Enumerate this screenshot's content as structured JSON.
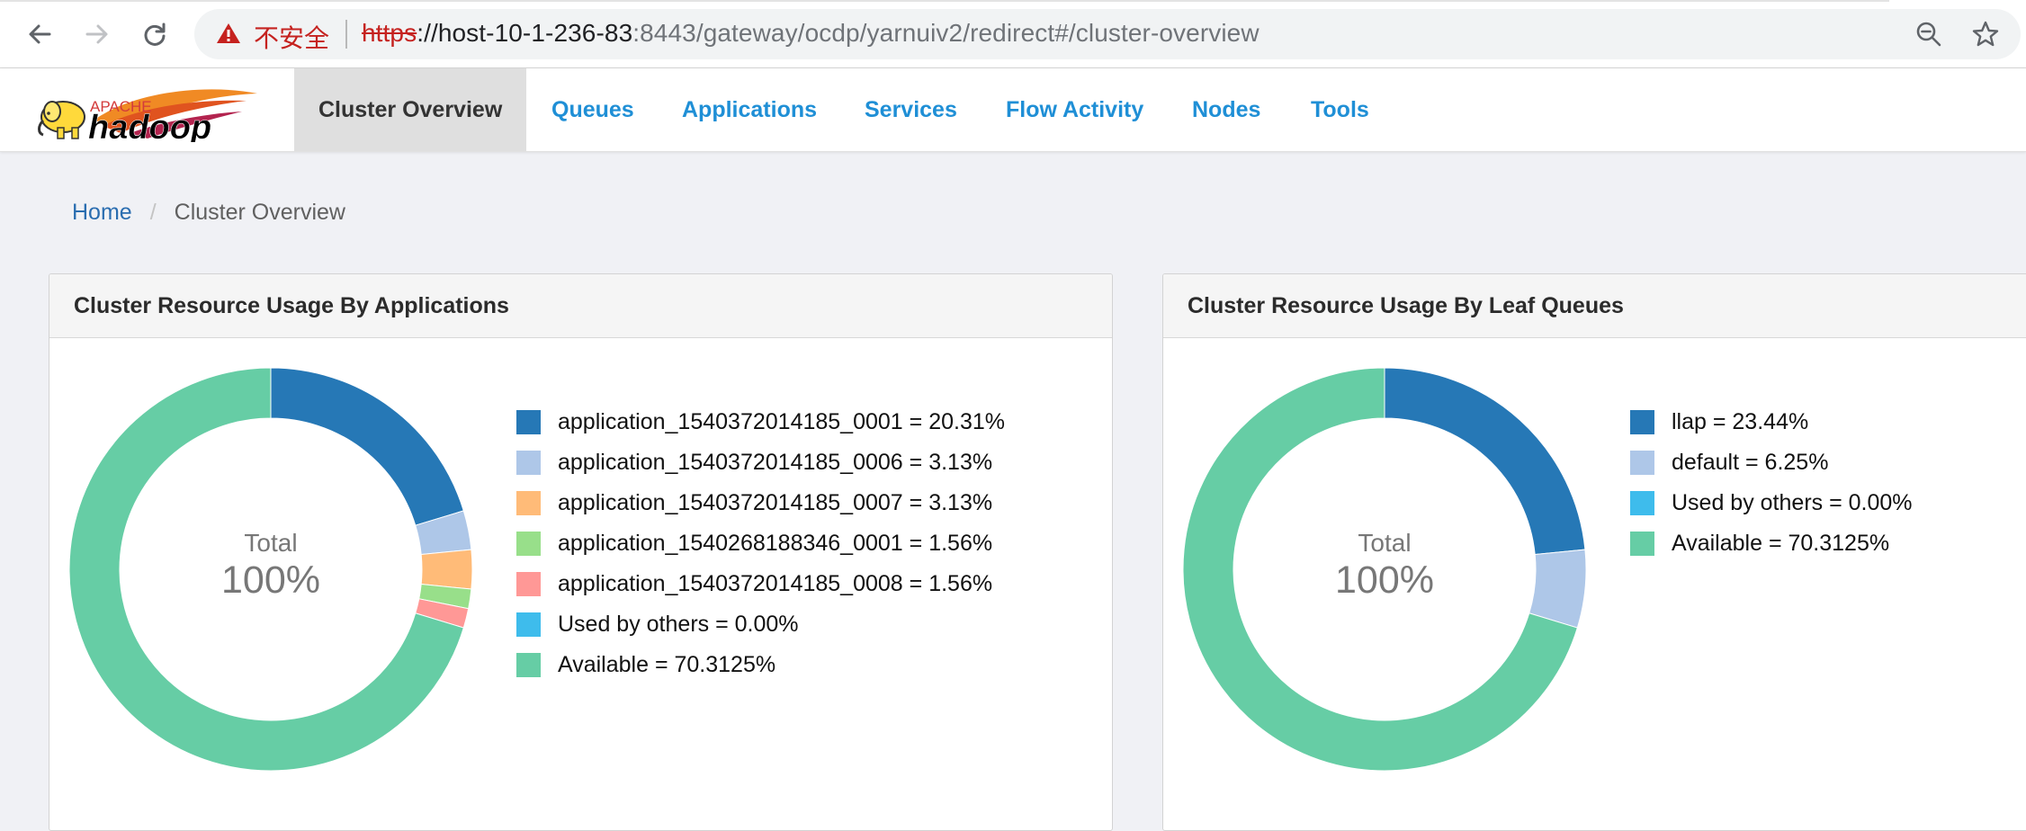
{
  "browser": {
    "security_label": "不安全",
    "url_scheme": "https",
    "url_host": "://host-10-1-236-83",
    "url_path": ":8443/gateway/ocdp/yarnuiv2/redirect#/cluster-overview"
  },
  "logo": {
    "apache": "APACHE",
    "hadoop": "hadoop"
  },
  "nav": {
    "active": "Cluster Overview",
    "items": [
      "Queues",
      "Applications",
      "Services",
      "Flow Activity",
      "Nodes",
      "Tools"
    ]
  },
  "breadcrumb": {
    "home": "Home",
    "separator": "/",
    "current": "Cluster Overview"
  },
  "chart_data": [
    {
      "type": "pie",
      "variant": "donut",
      "title": "Cluster Resource Usage By Applications",
      "center_label": "Total",
      "center_value": "100%",
      "slices": [
        {
          "label": "application_1540372014185_0001 = 20.31%",
          "value": 20.31,
          "color": "#2678b6"
        },
        {
          "label": "application_1540372014185_0006 = 3.13%",
          "value": 3.13,
          "color": "#aec7e8"
        },
        {
          "label": "application_1540372014185_0007 = 3.13%",
          "value": 3.13,
          "color": "#ffbb78"
        },
        {
          "label": "application_1540268188346_0001 = 1.56%",
          "value": 1.56,
          "color": "#98df8a"
        },
        {
          "label": "application_1540372014185_0008 = 1.56%",
          "value": 1.56,
          "color": "#ff9896"
        },
        {
          "label": "Used by others = 0.00%",
          "value": 0,
          "color": "#3ebcec"
        },
        {
          "label": "Available = 70.3125%",
          "value": 70.3125,
          "color": "#66cda5"
        }
      ]
    },
    {
      "type": "pie",
      "variant": "donut",
      "title": "Cluster Resource Usage By Leaf Queues",
      "center_label": "Total",
      "center_value": "100%",
      "slices": [
        {
          "label": "llap = 23.44%",
          "value": 23.44,
          "color": "#2678b6"
        },
        {
          "label": "default = 6.25%",
          "value": 6.25,
          "color": "#aec7e8"
        },
        {
          "label": "Used by others = 0.00%",
          "value": 0,
          "color": "#3ebcec"
        },
        {
          "label": "Available = 70.3125%",
          "value": 70.3125,
          "color": "#66cda5"
        }
      ]
    }
  ]
}
